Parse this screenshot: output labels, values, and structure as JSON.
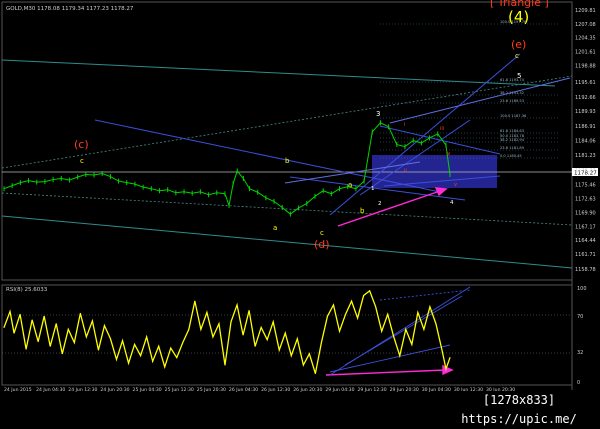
{
  "header": {
    "symbol_info": "GOLD,M30 1178.08 1179.34 1177.23 1178.27",
    "rsi_info": "RSI(8) 25.6033"
  },
  "watermark": "[1278x833] https://upic.me/",
  "colors": {
    "background": "#000000",
    "price_line": "#00d400",
    "rsi_line": "#ffff00",
    "wave_label_red": "#ff3b1f",
    "wave_label_yellow": "#ffff00",
    "trend_blue": "#3b4fd8",
    "channel_teal": "#2f8c8c",
    "divergence_arrow": "#ff2bd6",
    "zone_fill": "#2a2aaa",
    "price_box": "#ffffff"
  },
  "chart_data": [
    {
      "type": "line",
      "name": "price",
      "y_ticks": [
        "1209.81",
        "1207.08",
        "1204.35",
        "1201.61",
        "1198.88",
        "1195.61",
        "1192.66",
        "1189.93",
        "1186.91",
        "1184.06",
        "1181.23",
        "1178.27",
        "1175.46",
        "1172.63",
        "1169.90",
        "1167.17",
        "1164.44",
        "1161.71",
        "1158.78"
      ],
      "ylim": [
        1157,
        1211
      ],
      "current_price": "1178.27",
      "x_ticks": [
        "24 Jun 2015",
        "24 Jun 04:30",
        "24 Jun 12:30",
        "24 Jun 20:30",
        "25 Jun 04:30",
        "25 Jun 12:30",
        "25 Jun 20:30",
        "26 Jun 04:30",
        "26 Jun 12:30",
        "26 Jun 20:30",
        "29 Jun 04:30",
        "29 Jun 12:30",
        "29 Jun 20:30",
        "30 Jun 04:30",
        "30 Jun 12:30",
        "30 Jun 20:30"
      ],
      "series_points": [
        [
          0,
          1174.6
        ],
        [
          4,
          1175.2
        ],
        [
          8,
          1175.8
        ],
        [
          12,
          1176.2
        ],
        [
          16,
          1175.9
        ],
        [
          20,
          1176.0
        ],
        [
          24,
          1176.4
        ],
        [
          28,
          1176.6
        ],
        [
          32,
          1176.3
        ],
        [
          36,
          1176.9
        ],
        [
          40,
          1177.4
        ],
        [
          44,
          1177.3
        ],
        [
          48,
          1177.6
        ],
        [
          52,
          1177.0
        ],
        [
          56,
          1176.1
        ],
        [
          60,
          1175.8
        ],
        [
          64,
          1175.5
        ],
        [
          68,
          1174.9
        ],
        [
          72,
          1174.6
        ],
        [
          76,
          1174.2
        ],
        [
          80,
          1174.4
        ],
        [
          84,
          1173.8
        ],
        [
          88,
          1174.0
        ],
        [
          92,
          1173.7
        ],
        [
          96,
          1174.0
        ],
        [
          100,
          1173.4
        ],
        [
          104,
          1173.8
        ],
        [
          108,
          1173.6
        ],
        [
          110,
          1171.3
        ],
        [
          112,
          1175.6
        ],
        [
          114,
          1178.1
        ],
        [
          117,
          1176.6
        ],
        [
          120,
          1174.6
        ],
        [
          124,
          1173.9
        ],
        [
          128,
          1172.8
        ],
        [
          132,
          1172.1
        ],
        [
          136,
          1170.9
        ],
        [
          140,
          1169.6
        ],
        [
          144,
          1170.8
        ],
        [
          148,
          1171.7
        ],
        [
          152,
          1173.1
        ],
        [
          156,
          1174.2
        ],
        [
          160,
          1173.6
        ],
        [
          164,
          1174.6
        ],
        [
          168,
          1175.0
        ],
        [
          172,
          1174.6
        ],
        [
          176,
          1176.1
        ],
        [
          180,
          1185.8
        ],
        [
          184,
          1187.6
        ],
        [
          188,
          1186.8
        ],
        [
          192,
          1183.3
        ],
        [
          196,
          1182.9
        ],
        [
          200,
          1184.1
        ],
        [
          204,
          1183.6
        ],
        [
          208,
          1184.6
        ],
        [
          212,
          1185.4
        ],
        [
          216,
          1183.2
        ],
        [
          218,
          1177.4
        ]
      ]
    },
    {
      "type": "line",
      "name": "RSI(8)",
      "ylim": [
        0,
        100
      ],
      "y_ticks": [
        "100",
        "70",
        "32",
        "0"
      ],
      "series_points": [
        [
          0,
          58
        ],
        [
          3,
          75
        ],
        [
          5,
          52
        ],
        [
          8,
          72
        ],
        [
          11,
          35
        ],
        [
          14,
          66
        ],
        [
          17,
          43
        ],
        [
          20,
          70
        ],
        [
          23,
          38
        ],
        [
          26,
          62
        ],
        [
          29,
          30
        ],
        [
          32,
          56
        ],
        [
          35,
          42
        ],
        [
          38,
          73
        ],
        [
          41,
          48
        ],
        [
          44,
          65
        ],
        [
          47,
          34
        ],
        [
          50,
          60
        ],
        [
          53,
          46
        ],
        [
          56,
          24
        ],
        [
          59,
          44
        ],
        [
          62,
          20
        ],
        [
          65,
          40
        ],
        [
          68,
          28
        ],
        [
          71,
          48
        ],
        [
          74,
          22
        ],
        [
          77,
          38
        ],
        [
          80,
          16
        ],
        [
          83,
          36
        ],
        [
          86,
          26
        ],
        [
          89,
          42
        ],
        [
          92,
          56
        ],
        [
          95,
          86
        ],
        [
          98,
          56
        ],
        [
          101,
          74
        ],
        [
          104,
          48
        ],
        [
          107,
          62
        ],
        [
          110,
          18
        ],
        [
          113,
          64
        ],
        [
          116,
          82
        ],
        [
          119,
          50
        ],
        [
          122,
          76
        ],
        [
          125,
          38
        ],
        [
          128,
          58
        ],
        [
          131,
          45
        ],
        [
          134,
          64
        ],
        [
          137,
          34
        ],
        [
          140,
          52
        ],
        [
          143,
          28
        ],
        [
          146,
          46
        ],
        [
          149,
          18
        ],
        [
          152,
          30
        ],
        [
          155,
          9
        ],
        [
          158,
          42
        ],
        [
          161,
          70
        ],
        [
          164,
          82
        ],
        [
          167,
          54
        ],
        [
          170,
          72
        ],
        [
          173,
          86
        ],
        [
          176,
          68
        ],
        [
          179,
          92
        ],
        [
          182,
          97
        ],
        [
          185,
          80
        ],
        [
          188,
          54
        ],
        [
          191,
          72
        ],
        [
          194,
          48
        ],
        [
          197,
          28
        ],
        [
          200,
          56
        ],
        [
          203,
          40
        ],
        [
          206,
          74
        ],
        [
          209,
          56
        ],
        [
          212,
          80
        ],
        [
          215,
          62
        ],
        [
          218,
          34
        ],
        [
          220,
          14
        ],
        [
          222,
          26
        ]
      ]
    }
  ],
  "wave_labels": {
    "triangle": "[ Triangle ]",
    "wave_4": "(4)",
    "wave_e_paren": "(e)",
    "wave_c_paren": "(c)",
    "wave_d_paren": "(d)",
    "lbl_c_left": "c",
    "lbl_b": "b",
    "lbl_a": "a",
    "lbl_c_low": "c",
    "lbl_a2": "a",
    "lbl_b2": "b",
    "lbl_1": "1",
    "lbl_2": "2",
    "lbl_3": "3",
    "lbl_4": "4",
    "lbl_5": "5",
    "lbl_c_right": "c",
    "lbl_i": "i",
    "lbl_ii": "ii",
    "lbl_iii": "iii",
    "lbl_iv": "iv",
    "lbl_v": "v"
  },
  "fib_levels": [
    "100.0 1197.76",
    "61.8 1193.74",
    "38.2 1191.32",
    "23.6 1189.53",
    "100.0 1187.36",
    "61.8 1184.63",
    "50.0 1183.78",
    "38.2 1182.94",
    "23.6 1181.89",
    "0.0 1180.45"
  ]
}
